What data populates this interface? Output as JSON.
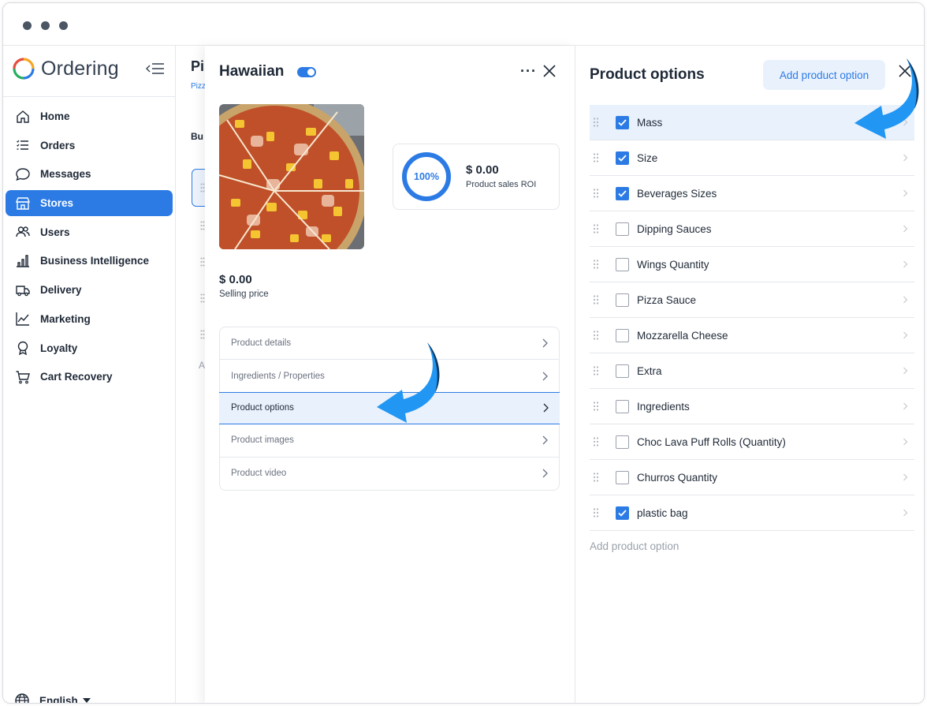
{
  "app": {
    "logo_text": "Ordering"
  },
  "sidebar": {
    "items": [
      {
        "label": "Home",
        "icon": "home-icon"
      },
      {
        "label": "Orders",
        "icon": "list-icon"
      },
      {
        "label": "Messages",
        "icon": "chat-icon"
      },
      {
        "label": "Stores",
        "icon": "store-icon",
        "active": true
      },
      {
        "label": "Users",
        "icon": "users-icon"
      },
      {
        "label": "Business Intelligence",
        "icon": "bar-chart-icon"
      },
      {
        "label": "Delivery",
        "icon": "truck-icon"
      },
      {
        "label": "Marketing",
        "icon": "line-chart-icon"
      },
      {
        "label": "Loyalty",
        "icon": "award-icon"
      },
      {
        "label": "Cart Recovery",
        "icon": "cart-icon"
      }
    ],
    "language": "English"
  },
  "background_page": {
    "title_fragment": "Pi",
    "sub_fragment": "Pizz",
    "bus_fragment": "Bu",
    "a_fragment": "A"
  },
  "product": {
    "name": "Hawaiian",
    "enabled": true,
    "roi_percent": "100%",
    "roi_value": "$ 0.00",
    "roi_label": "Product sales ROI",
    "price_value": "$ 0.00",
    "price_label": "Selling price",
    "menu": [
      {
        "label": "Product details"
      },
      {
        "label": "Ingredients / Properties"
      },
      {
        "label": "Product options",
        "active": true
      },
      {
        "label": "Product images"
      },
      {
        "label": "Product video"
      }
    ]
  },
  "options_panel": {
    "title": "Product options",
    "add_button": "Add product option",
    "add_link": "Add product option",
    "options": [
      {
        "label": "Mass",
        "checked": true,
        "selected": true
      },
      {
        "label": "Size",
        "checked": true
      },
      {
        "label": "Beverages Sizes",
        "checked": true
      },
      {
        "label": "Dipping Sauces",
        "checked": false
      },
      {
        "label": "Wings Quantity",
        "checked": false
      },
      {
        "label": "Pizza Sauce",
        "checked": false
      },
      {
        "label": "Mozzarella Cheese",
        "checked": false
      },
      {
        "label": "Extra",
        "checked": false
      },
      {
        "label": "Ingredients",
        "checked": false
      },
      {
        "label": "Choc Lava Puff Rolls (Quantity)",
        "checked": false
      },
      {
        "label": "Churros Quantity",
        "checked": false
      },
      {
        "label": "plastic bag",
        "checked": true
      }
    ]
  },
  "colors": {
    "accent": "#2c7be5",
    "selected_bg": "#e9f1fd",
    "arrow": "#2196f3",
    "arrow_dark": "#0d3b66"
  }
}
